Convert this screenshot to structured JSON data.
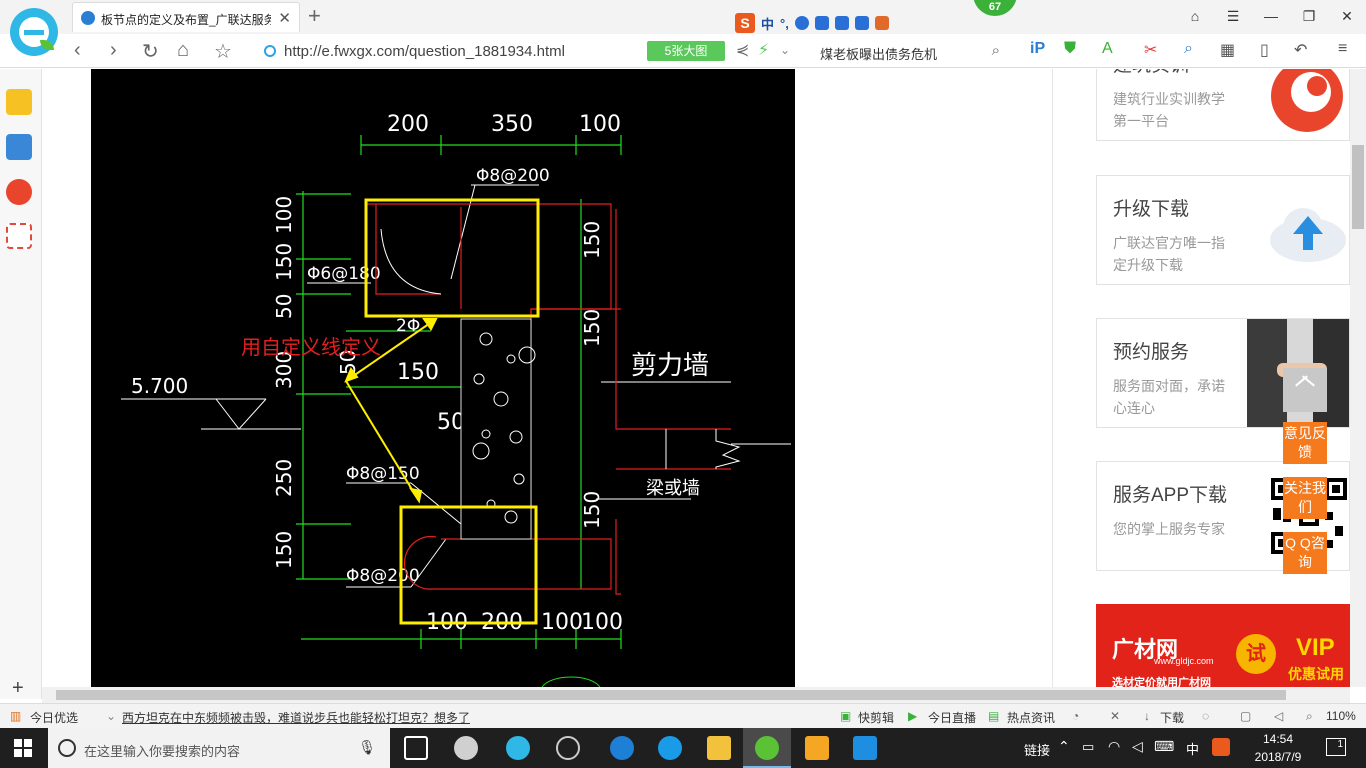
{
  "browser": {
    "tab_title": "板节点的定义及布置_广联达服务",
    "tab_close": "✕",
    "new_tab": "+",
    "sogou_mark": "S",
    "sogou_cn": "中",
    "badge": "67",
    "url": "http://e.fwxgx.com/question_1881934.html",
    "big_image_button": "5张大图",
    "search_text": "煤老板曝出债务危机",
    "colors": {
      "accent": "#2fb7e6",
      "green": "#5bc85b",
      "orange": "#f57a1d"
    }
  },
  "cad": {
    "dims_top": [
      "200",
      "350",
      "100"
    ],
    "dims_left": [
      "100",
      "150",
      "50",
      "300",
      "250",
      "150"
    ],
    "dims_bottom": [
      "100",
      "200",
      "100",
      "100"
    ],
    "dims_right": [
      "150",
      "150",
      "150"
    ],
    "rebar_top": "Φ8@200",
    "rebar_left": "Φ6@180",
    "rebar_bar": "2Φ",
    "rebar_mid": "Φ8@150",
    "rebar_bottom": "Φ8@200",
    "dim_150": "150",
    "dim_50_a": "50",
    "dim_50_b": "50",
    "elevation": "5.700",
    "shear_wall": "剪力墙",
    "beam_wall": "梁或墙",
    "annotation": "用自定义线定义"
  },
  "side_cards": [
    {
      "title": "建筑实训",
      "sub": "建筑行业实训教学第一平台"
    },
    {
      "title": "升级下载",
      "sub": "广联达官方唯一指定升级下载"
    },
    {
      "title": "预约服务",
      "sub": "服务面对面，承诺心连心"
    },
    {
      "title": "服务APP下载",
      "sub": "您的掌上服务专家"
    }
  ],
  "ad": {
    "brand": "广材网",
    "url": "www.gldjc.com",
    "try": "试",
    "vip": "VIP",
    "vip_sub": "优惠试用",
    "slogan": "选材定价就用广材网"
  },
  "float": {
    "feedback": "意见反馈",
    "follow": "关注我们",
    "qq": "Q Q咨询"
  },
  "statusbar": {
    "today": "今日优选",
    "news": "西方坦克在中东频频被击毁，难道说步兵也能轻松打坦克？想多了",
    "quick_cut": "快剪辑",
    "live": "今日直播",
    "hot": "热点资讯",
    "download": "下载",
    "zoom": "110%"
  },
  "taskbar": {
    "search_placeholder": "在这里输入你要搜索的内容",
    "links": "链接",
    "ime": "中",
    "time": "14:54",
    "date": "2018/7/9",
    "notify_count": "1"
  }
}
